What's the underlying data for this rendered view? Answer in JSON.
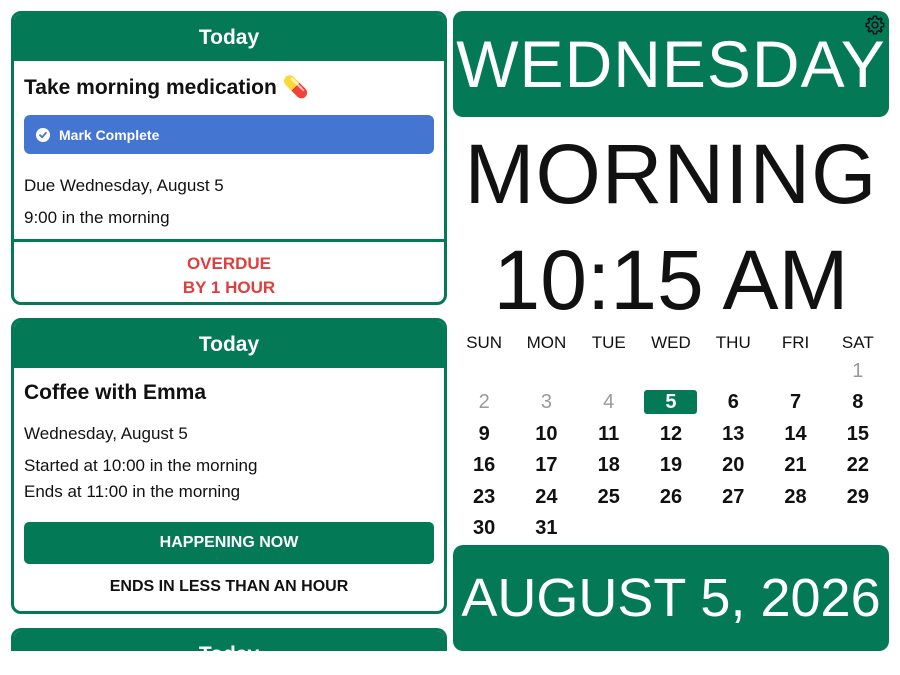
{
  "reminder_card": {
    "header": "Today",
    "title": "Take morning medication 💊",
    "mark_complete_label": "Mark Complete",
    "due": "Due Wednesday, August 5",
    "due_time": "9:00 in the morning",
    "status_line1": "OVERDUE",
    "status_line2": "BY 1 HOUR"
  },
  "event_card": {
    "header": "Today",
    "title": "Coffee with Emma",
    "date": "Wednesday, August 5",
    "started": "Started at 10:00 in the morning",
    "ends": "Ends at 11:00 in the morning",
    "happening_label": "HAPPENING NOW",
    "ends_note": "ENDS IN LESS THAN AN HOUR"
  },
  "partial_card": {
    "header": "Today"
  },
  "clock": {
    "day": "WEDNESDAY",
    "period": "MORNING",
    "time": "10:15 AM",
    "date": "AUGUST 5, 2026"
  },
  "calendar": {
    "weekdays": [
      "SUN",
      "MON",
      "TUE",
      "WED",
      "THU",
      "FRI",
      "SAT"
    ],
    "weeks": [
      [
        "",
        "",
        "",
        "",
        "",
        "",
        "1"
      ],
      [
        "2",
        "3",
        "4",
        "5",
        "6",
        "7",
        "8"
      ],
      [
        "9",
        "10",
        "11",
        "12",
        "13",
        "14",
        "15"
      ],
      [
        "16",
        "17",
        "18",
        "19",
        "20",
        "21",
        "22"
      ],
      [
        "23",
        "24",
        "25",
        "26",
        "27",
        "28",
        "29"
      ],
      [
        "30",
        "31",
        "",
        "",
        "",
        "",
        ""
      ]
    ],
    "past_days": [
      "1",
      "2",
      "3",
      "4"
    ],
    "today": "5"
  },
  "icons": {
    "settings": "gear-icon",
    "complete": "check-circle-icon"
  },
  "colors": {
    "accent": "#037a55",
    "button": "#4476d1",
    "overdue": "#e23d3d"
  }
}
